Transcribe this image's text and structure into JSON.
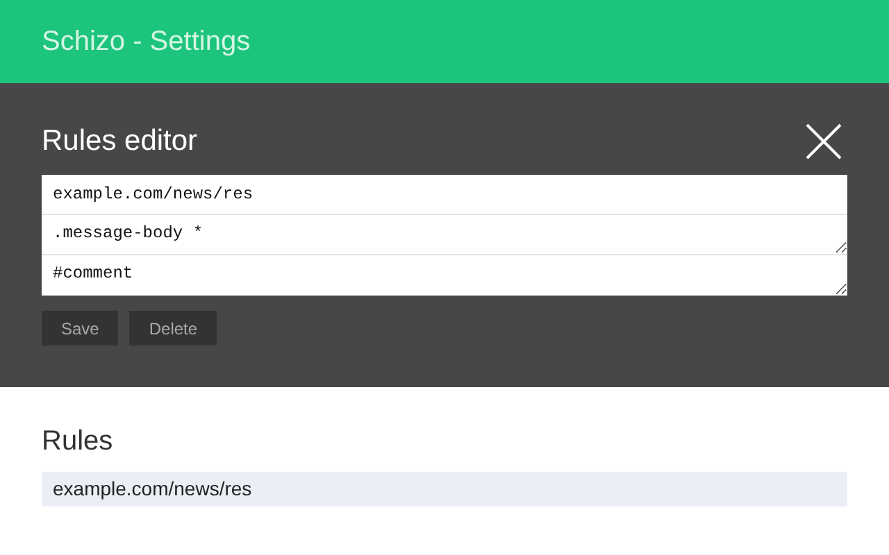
{
  "header": {
    "title": "Schizo - Settings"
  },
  "editor": {
    "title": "Rules editor",
    "fields": [
      {
        "kind": "input",
        "value": "example.com/news/res"
      },
      {
        "kind": "textarea",
        "value": ".message-body *"
      },
      {
        "kind": "textarea",
        "value": "#comment"
      }
    ],
    "buttons": [
      "Save",
      "Delete"
    ]
  },
  "rules": {
    "title": "Rules",
    "items": [
      {
        "text": "example.com/news/res"
      }
    ]
  }
}
